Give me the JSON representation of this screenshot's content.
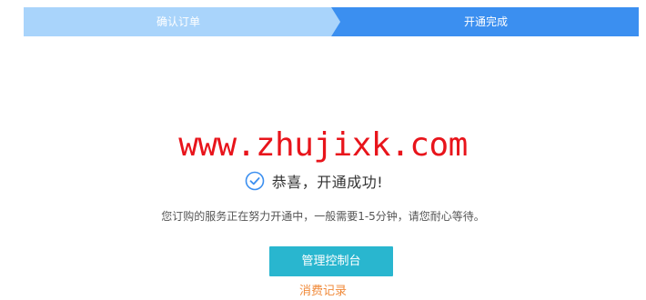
{
  "stepper": {
    "steps": [
      {
        "label": "确认订单",
        "state": "done"
      },
      {
        "label": "开通完成",
        "state": "active"
      }
    ],
    "colors": {
      "done": "#a9d4fb",
      "active": "#3b8ff0"
    }
  },
  "watermark": {
    "text": "www.zhujixk.com",
    "color": "#e8141b"
  },
  "success": {
    "icon": "check-circle-icon",
    "text": "恭喜，开通成功!"
  },
  "message": "您订购的服务正在努力开通中，一般需要1-5分钟，请您耐心等待。",
  "actions": {
    "manage_console_label": "管理控制台",
    "manage_console_color": "#29b6cf",
    "records_label": "消费记录",
    "records_color": "#f08a3a"
  }
}
